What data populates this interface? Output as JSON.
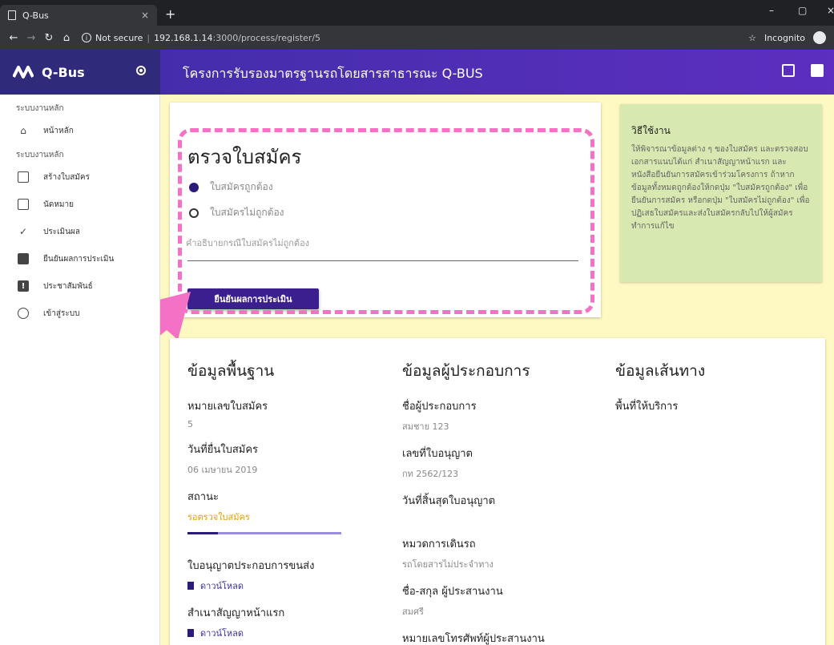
{
  "browser": {
    "tab_title": "Q-Bus",
    "tab_close": "×",
    "new_tab": "+",
    "url_security": "Not secure",
    "url_host": "192.168.1.14",
    "url_path": ":3000/process/register/5",
    "incognito": "Incognito"
  },
  "header": {
    "brand": "Q-Bus",
    "title": "โครงการรับรองมาตรฐานรถโดยสารสาธารณะ Q-BUS"
  },
  "sidebar": {
    "section1": "ระบบงานหลัก",
    "home": "หน้าหลัก",
    "section2": "ระบบงานหลัก",
    "items": [
      {
        "label": "สร้างใบสมัคร",
        "icon": "clipboard-icon"
      },
      {
        "label": "นัดหมาย",
        "icon": "chat-icon"
      },
      {
        "label": "ประเมินผล",
        "icon": "check-icon"
      },
      {
        "label": "ยืนยันผลการประเมิน",
        "icon": "book-icon"
      },
      {
        "label": "ประชาสัมพันธ์",
        "icon": "announcement-icon"
      },
      {
        "label": "เข้าสู่ระบบ",
        "icon": "face-icon"
      }
    ]
  },
  "review": {
    "title": "ตรวจใบสมัคร",
    "option_valid": "ใบสมัครถูกต้อง",
    "option_invalid": "ใบสมัครไม่ถูกต้อง",
    "reason_label": "คำอธิบายกรณีใบสมัครไม่ถูกต้อง",
    "reason_value": "",
    "confirm_label": "ยืนยันผลการประเมิน"
  },
  "howto": {
    "title": "วิธีใช้งาน",
    "body": "ให้พิจารณาข้อมูลต่าง ๆ ของใบสมัคร และตรวจสอบเอกสารแนบได้แก่ สำเนาสัญญาหน้าแรก และ หนังสือยืนยันการสมัครเข้าร่วมโครงการ ถ้าหากข้อมูลทั้งหมดถูกต้องให้กดปุ่ม \"ใบสมัครถูกต้อง\" เพื่อยืนยันการสมัคร หรือกดปุ่ม \"ใบสมัครไม่ถูกต้อง\" เพื่อปฏิเสธใบสมัครและส่งใบสมัครกลับไปให้ผู้สมัครทำการแก้ไข"
  },
  "basic": {
    "title": "ข้อมูลพื้นฐาน",
    "app_no_label": "หมายเลขใบสมัคร",
    "app_no": "5",
    "date_label": "วันที่ยื่นใบสมัคร",
    "date": "06 เมษายน 2019",
    "status_label": "สถานะ",
    "status": "รอตรวจใบสมัคร",
    "status_progress": 0.2,
    "license_label": "ใบอนุญาตประกอบการขนส่ง",
    "download": "ดาวน์โหลด",
    "contract_label": "สำเนาสัญญาหน้าแรก",
    "download2": "ดาวน์โหลด"
  },
  "operator": {
    "title": "ข้อมูลผู้ประกอบการ",
    "name_label": "ชื่อผู้ประกอบการ",
    "name": "สมชาย 123",
    "license_no_label": "เลขที่ใบอนุญาต",
    "license_no": "กท 2562/123",
    "expiry_label": "วันที่สิ้นสุดใบอนุญาต",
    "expiry": "",
    "category_label": "หมวดการเดินรถ",
    "category": "รถโดยสารไม่ประจำทาง",
    "coordinator_label": "ชื่อ-สกุล ผู้ประสานงาน",
    "coordinator": "สมศรี",
    "phone_label": "หมายเลขโทรศัพท์ผู้ประสานงาน"
  },
  "route": {
    "title": "ข้อมูลเส้นทาง",
    "area_label": "พื้นที่ให้บริการ"
  },
  "colors": {
    "sidebar_header": "#2f2a7a",
    "primary": "#3b1f8e",
    "highlight": "#f472c6",
    "background": "#fef9c3",
    "howto_bg": "#d7e8b0",
    "status": "#e6a000"
  }
}
